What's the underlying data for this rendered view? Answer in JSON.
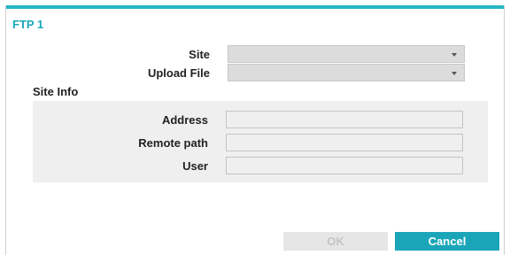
{
  "dialog": {
    "title": "FTP 1"
  },
  "form": {
    "site_label": "Site",
    "site_value": "",
    "upload_file_label": "Upload File",
    "upload_file_value": ""
  },
  "site_info": {
    "section_label": "Site Info",
    "address_label": "Address",
    "address_value": "",
    "remote_path_label": "Remote path",
    "remote_path_value": "",
    "user_label": "User",
    "user_value": ""
  },
  "buttons": {
    "ok_label": "OK",
    "cancel_label": "Cancel"
  },
  "colors": {
    "accent": "#1aa6b8",
    "top_bar": "#27b7c4",
    "panel_bg": "#efefef",
    "disabled_text": "#c4c4c4"
  },
  "icons": {
    "dropdown_arrow": "chevron-down-icon"
  }
}
